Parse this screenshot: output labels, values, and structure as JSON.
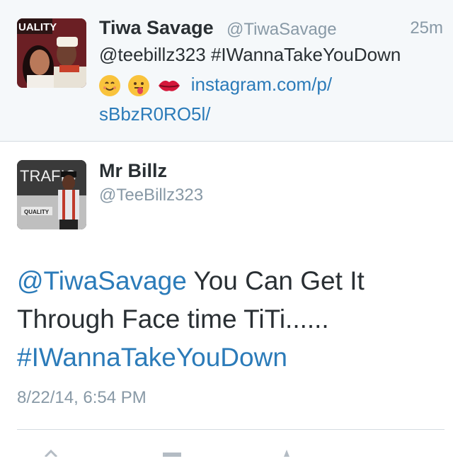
{
  "tweet1": {
    "name": "Tiwa Savage",
    "handle": "@TiwaSavage",
    "time": "25m",
    "mention": "@teebillz323",
    "hashtag": "#IWannaTakeYouDown",
    "link_line1": "instagram.com/p/",
    "link_line2": "sBbzR0RO5l/",
    "avatar_text": "UALITY",
    "emojis": [
      "smiling-face-icon",
      "tongue-face-icon",
      "kiss-lips-icon"
    ]
  },
  "tweet2": {
    "name": "Mr Billz",
    "handle": "@TeeBillz323",
    "mention": "@TiwaSavage",
    "text_part1": " You Can Get It",
    "text_line2": "Through Face time TiTi......",
    "hashtag": "#IWannaTakeYouDown",
    "timestamp": "8/22/14, 6:54 PM",
    "avatar_text": "TRAFIC",
    "avatar_subtext": "QUALITY"
  },
  "colors": {
    "link": "#2b7bb9",
    "secondary_text": "#8899a6",
    "primary_text": "#292f33",
    "top_background": "#f5f8fa"
  }
}
